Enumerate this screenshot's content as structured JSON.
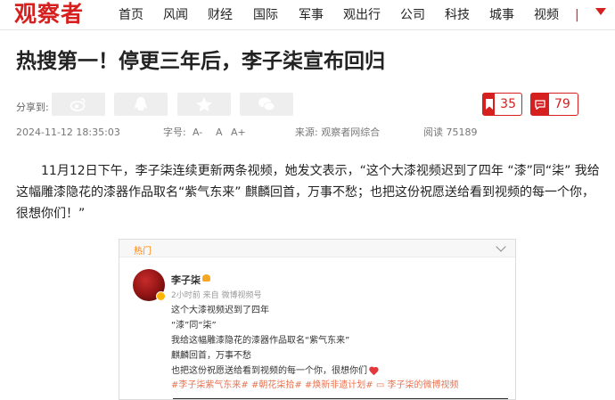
{
  "site": {
    "logo_text": "观察者",
    "brand_color": "#d6201f"
  },
  "nav": {
    "items": [
      "首页",
      "风闻",
      "财经",
      "国际",
      "军事",
      "观出行",
      "公司",
      "科技",
      "城事",
      "视频"
    ],
    "separator": "|"
  },
  "article": {
    "headline": "热搜第一！停更三年后，李子柒宣布回归",
    "share_label": "分享到:",
    "share_icons": [
      "weibo-icon",
      "qq-icon",
      "qzone-icon",
      "wechat-icon"
    ],
    "likes": "35",
    "comments": "79",
    "datetime": "2024-11-12 18:35:03",
    "font_label": "字号:",
    "font_small": "A-",
    "font_normal": "A",
    "font_large": "A+",
    "source": "来源: 观察者网综合",
    "views": "阅读 75189",
    "paragraph": "11月12日下午，李子柒连续更新两条视频，她发文表示，“这个大漆视频迟到了四年 “漆”同“柒” 我给这幅雕漆隐花的漆器作品取名“紫气东来” 麒麟回首，万事不愁；也把这份祝愿送给看到视频的每一个你，很想你们！”"
  },
  "weibo_card": {
    "tag": "热门",
    "user_name": "李子柒",
    "post_meta": "2小时前 来自 微博视频号",
    "lines": [
      "这个大漆视频迟到了四年",
      "“漆”同“柒”",
      "我给这幅雕漆隐花的漆器作品取名“紫气东来”",
      "麒麟回首，万事不愁",
      "也把这份祝愿送给看到视频的每一个你，很想你们"
    ],
    "tags": [
      "#李子柒紫气东来#",
      "#朝花柒拾#",
      "#焕新非遗计划#",
      "李子柒的微博视频"
    ]
  }
}
